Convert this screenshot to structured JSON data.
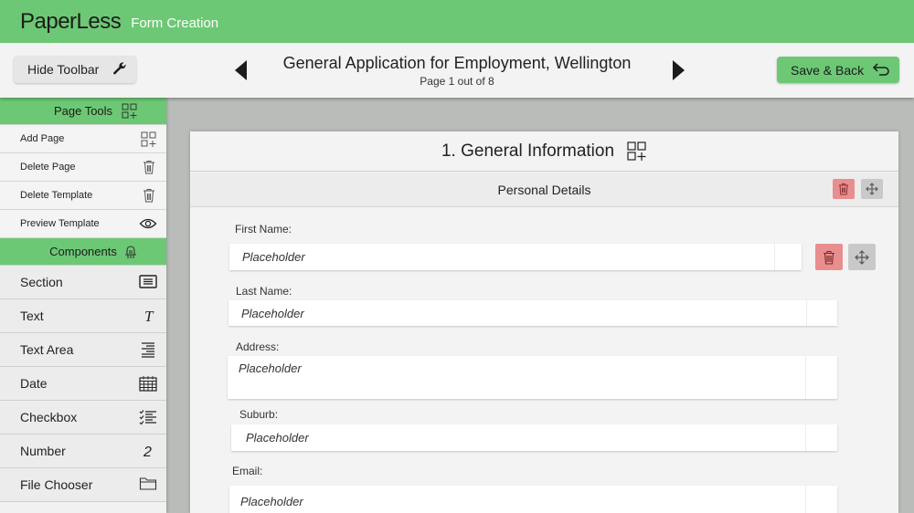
{
  "app": {
    "brand": "PaperLess",
    "subtitle": "Form Creation"
  },
  "toolbar": {
    "hide_label": "Hide Toolbar",
    "doc_title": "General Application for Employment, Wellington",
    "page_info": "Page 1 out of 8",
    "save_label": "Save & Back"
  },
  "sidebar": {
    "page_tools_title": "Page Tools",
    "page_tools": [
      {
        "label": "Add Page",
        "icon": "add-grid-icon"
      },
      {
        "label": "Delete Page",
        "icon": "trash-icon"
      },
      {
        "label": "Delete Template",
        "icon": "trash-icon"
      },
      {
        "label": "Preview Template",
        "icon": "eye-icon"
      }
    ],
    "components_title": "Components",
    "components": [
      {
        "label": "Section",
        "icon": "section-icon"
      },
      {
        "label": "Text",
        "icon": "text-icon"
      },
      {
        "label": "Text Area",
        "icon": "text-area-icon"
      },
      {
        "label": "Date",
        "icon": "calendar-icon"
      },
      {
        "label": "Checkbox",
        "icon": "checklist-icon"
      },
      {
        "label": "Number",
        "icon": "number-icon"
      },
      {
        "label": "File Chooser",
        "icon": "folder-icon"
      }
    ]
  },
  "form": {
    "section_title": "1. General Information",
    "group_title": "Personal Details",
    "fields": [
      {
        "label": "First Name:",
        "placeholder": "Placeholder"
      },
      {
        "label": "Last Name:",
        "placeholder": "Placeholder"
      },
      {
        "label": "Address:",
        "placeholder": "Placeholder"
      },
      {
        "label": "Suburb:",
        "placeholder": "Placeholder"
      },
      {
        "label": "Email:",
        "placeholder": "Placeholder"
      }
    ]
  },
  "colors": {
    "accent": "#6cc874",
    "delete": "#e98e8e",
    "move": "#c9c9c9",
    "canvas": "#b9bcb9"
  }
}
